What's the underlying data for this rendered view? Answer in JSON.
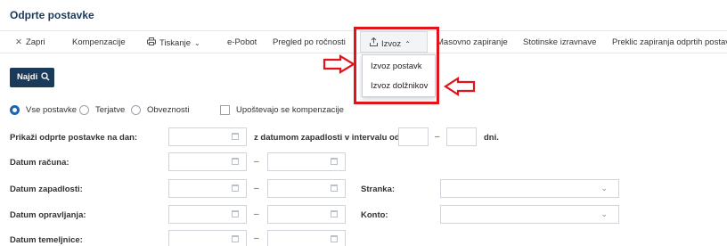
{
  "page": {
    "title": "Odprte postavke"
  },
  "toolbar": {
    "zapri_label": "Zapri",
    "kompenzacije_label": "Kompenzacije",
    "tiskanje_label": "Tiskanje",
    "epobot_label": "e-Pobot",
    "pregled_label": "Pregled po ročnosti",
    "izvoz_label": "Izvoz",
    "masovno_label": "Masovno zapiranje",
    "stotinske_label": "Stotinske izravnave",
    "preklic_label": "Preklic zapiranja odprtih postavk"
  },
  "dropdown": {
    "items": [
      "Izvoz postavk",
      "Izvoz dolžnikov"
    ]
  },
  "search": {
    "najdi_label": "Najdi"
  },
  "filters": {
    "radio_options": [
      "Vse postavke",
      "Terjatve",
      "Obveznosti"
    ],
    "selected_radio": "Vse postavke",
    "checkbox_label": "Upoštevajo se kompenzacije",
    "checkbox_checked": false
  },
  "form": {
    "prikazi_label": "Prikaži odprte postavke na dan:",
    "interval_label": "z datumom zapadlosti v intervalu od",
    "dni_label": "dni.",
    "datum_racuna_label": "Datum računa:",
    "datum_zapadlosti_label": "Datum zapadlosti:",
    "datum_opravljanja_label": "Datum opravljanja:",
    "datum_temeljnice_label": "Datum temeljnice:",
    "stranka_label": "Stranka:",
    "konto_label": "Konto:"
  },
  "colors": {
    "title": "#1a3a5c",
    "primary_button": "#1a3a5c",
    "radio_checked": "#1a66b3",
    "highlight": "#e0141a"
  },
  "icons": {
    "zapri": "close-icon",
    "tiskanje": "printer-icon",
    "izvoz": "export-icon",
    "najdi": "search-icon"
  }
}
